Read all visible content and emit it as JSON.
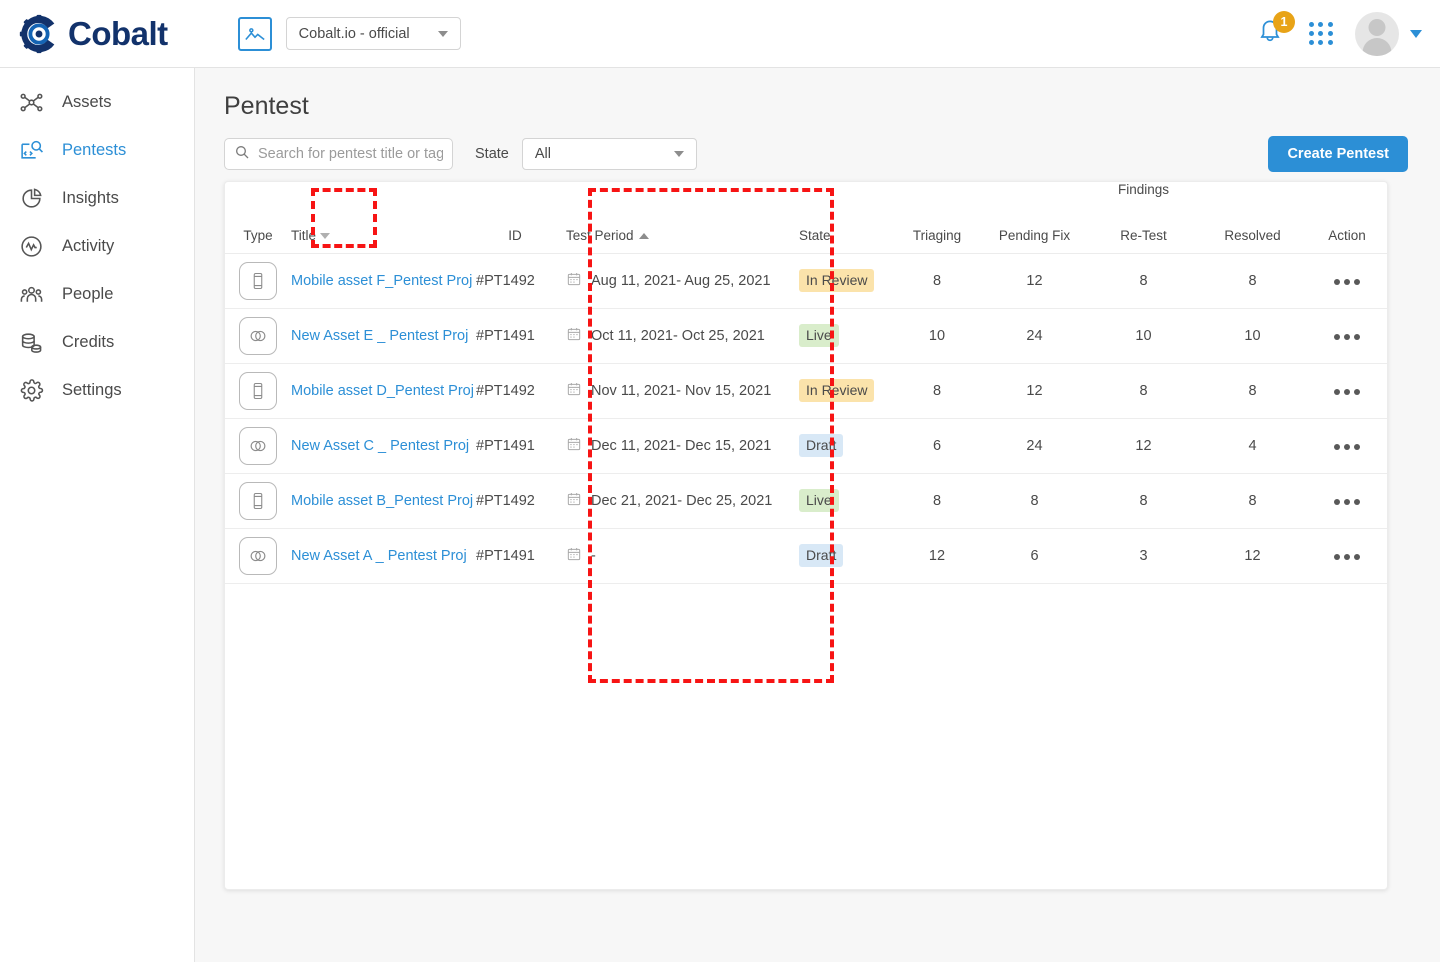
{
  "brand": {
    "name": "Cobalt",
    "logo_icon": "cobalt-gear-logo",
    "color": "#12326b",
    "accent": "#2c8fd6"
  },
  "topbar": {
    "org_icon": "image-placeholder-icon",
    "org_selected": "Cobalt.io - official",
    "notification_icon": "bell-icon",
    "notification_count": "1",
    "apps_icon": "apps-grid-icon",
    "avatar_icon": "user-avatar",
    "avatar_caret": "chevron-down-icon"
  },
  "sidebar": {
    "items": [
      {
        "label": "Assets",
        "icon": "assets-network-icon",
        "active": false
      },
      {
        "label": "Pentests",
        "icon": "pentests-code-search-icon",
        "active": true
      },
      {
        "label": "Insights",
        "icon": "insights-piechart-icon",
        "active": false
      },
      {
        "label": "Activity",
        "icon": "activity-pulse-icon",
        "active": false
      },
      {
        "label": "People",
        "icon": "people-group-icon",
        "active": false
      },
      {
        "label": "Credits",
        "icon": "credits-coins-icon",
        "active": false
      },
      {
        "label": "Settings",
        "icon": "settings-gear-icon",
        "active": false
      }
    ]
  },
  "main": {
    "title": "Pentest",
    "search": {
      "placeholder": "Search for pentest title or tag",
      "value": "",
      "icon": "search-icon"
    },
    "state_filter": {
      "label": "State",
      "value": "All",
      "caret": "chevron-down-icon"
    },
    "create_button": "Create Pentest"
  },
  "table": {
    "group_header": "Findings",
    "columns": {
      "type": "Type",
      "title": "Title",
      "title_sort": "descending",
      "id": "ID",
      "period": "Test Period",
      "period_sort": "ascending",
      "state": "State",
      "triaging": "Triaging",
      "pending_fix": "Pending Fix",
      "retest": "Re-Test",
      "resolved": "Resolved",
      "action": "Action"
    },
    "rows": [
      {
        "type_icon": "mobile-phone-icon",
        "title": "Mobile asset F_Pentest Proj",
        "id": "#PT1492",
        "period": "Aug 11, 2021- Aug 25, 2021",
        "state": "In Review",
        "state_kind": "review",
        "triaging": "8",
        "pending_fix": "12",
        "retest": "8",
        "resolved": "8",
        "action_icon": "more-options-icon"
      },
      {
        "type_icon": "overlapping-circles-icon",
        "title": "New Asset E _ Pentest Proj",
        "id": "#PT1491",
        "period": "Oct 11, 2021- Oct 25, 2021",
        "state": "Live",
        "state_kind": "live",
        "triaging": "10",
        "pending_fix": "24",
        "retest": "10",
        "resolved": "10",
        "action_icon": "more-options-icon"
      },
      {
        "type_icon": "mobile-phone-icon",
        "title": "Mobile asset D_Pentest Proj",
        "id": "#PT1492",
        "period": "Nov 11, 2021- Nov 15, 2021",
        "state": "In Review",
        "state_kind": "review",
        "triaging": "8",
        "pending_fix": "12",
        "retest": "8",
        "resolved": "8",
        "action_icon": "more-options-icon"
      },
      {
        "type_icon": "overlapping-circles-icon",
        "title": "New Asset C _ Pentest Proj",
        "id": "#PT1491",
        "period": "Dec 11, 2021- Dec 15, 2021",
        "state": "Draft",
        "state_kind": "draft",
        "triaging": "6",
        "pending_fix": "24",
        "retest": "12",
        "resolved": "4",
        "action_icon": "more-options-icon"
      },
      {
        "type_icon": "mobile-phone-icon",
        "title": "Mobile asset B_Pentest Proj",
        "id": "#PT1492",
        "period": "Dec 21, 2021- Dec 25, 2021",
        "state": "Live",
        "state_kind": "live",
        "triaging": "8",
        "pending_fix": "8",
        "retest": "8",
        "resolved": "8",
        "action_icon": "more-options-icon"
      },
      {
        "type_icon": "overlapping-circles-icon",
        "title": "New Asset A _ Pentest Proj",
        "id": "#PT1491",
        "period": "-",
        "state": "Draft",
        "state_kind": "draft",
        "triaging": "12",
        "pending_fix": "6",
        "retest": "3",
        "resolved": "12",
        "action_icon": "more-options-icon"
      }
    ]
  },
  "annotations": {
    "color": "#f71414",
    "boxes": [
      {
        "name": "title-column-highlight"
      },
      {
        "name": "test-period-column-highlight"
      }
    ]
  },
  "badge_colors": {
    "review": "#fbe3ab",
    "live": "#d9edcb",
    "draft": "#d8e8f6"
  }
}
